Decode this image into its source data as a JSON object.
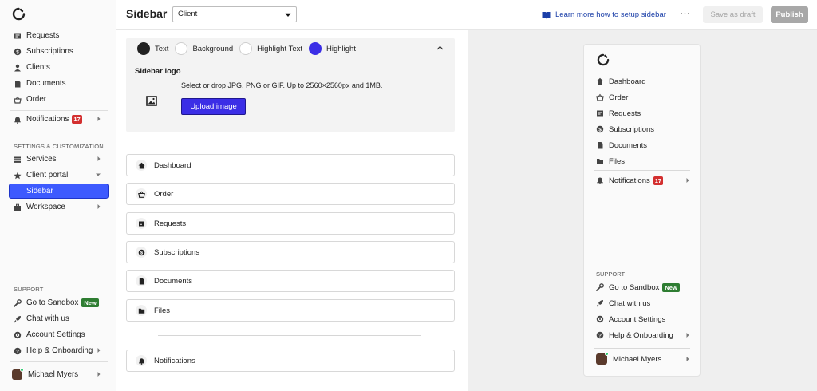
{
  "sidebar": {
    "main_items": [
      {
        "label": "Requests",
        "icon": "requests-icon"
      },
      {
        "label": "Subscriptions",
        "icon": "subscriptions-icon"
      },
      {
        "label": "Clients",
        "icon": "clients-icon"
      },
      {
        "label": "Documents",
        "icon": "documents-icon"
      },
      {
        "label": "Order",
        "icon": "order-icon"
      }
    ],
    "notifications": {
      "label": "Notifications",
      "badge": "17"
    },
    "settings_header": "SETTINGS & CUSTOMIZATION",
    "settings_items": [
      {
        "label": "Services"
      },
      {
        "label": "Client portal"
      },
      {
        "label": "Sidebar"
      },
      {
        "label": "Workspace"
      }
    ],
    "support_header": "SUPPORT",
    "support_items": [
      {
        "label": "Go to Sandbox",
        "badge": "New"
      },
      {
        "label": "Chat with us"
      },
      {
        "label": "Account Settings"
      },
      {
        "label": "Help & Onboarding"
      }
    ],
    "user": {
      "name": "Michael Myers"
    }
  },
  "header": {
    "title": "Sidebar",
    "select_value": "Client",
    "learn_link": "Learn more how to setup sidebar",
    "more_label": "···",
    "draft_label": "Save as draft",
    "publish_label": "Publish"
  },
  "editor": {
    "colors": [
      {
        "label": "Text",
        "color": "#222222"
      },
      {
        "label": "Background",
        "color": "#ffffff"
      },
      {
        "label": "Highlight Text",
        "color": "#ffffff"
      },
      {
        "label": "Highlight",
        "color": "#3b2ee6"
      }
    ],
    "logo_heading": "Sidebar logo",
    "logo_hint": "Select or drop JPG, PNG or GIF. Up to 2560×2560px and 1MB.",
    "upload_label": "Upload image",
    "rows": [
      {
        "label": "Dashboard"
      },
      {
        "label": "Order"
      },
      {
        "label": "Requests"
      },
      {
        "label": "Subscriptions"
      },
      {
        "label": "Documents"
      },
      {
        "label": "Files"
      }
    ],
    "notifications_row": "Notifications"
  },
  "preview": {
    "items": [
      {
        "label": "Dashboard"
      },
      {
        "label": "Order"
      },
      {
        "label": "Requests"
      },
      {
        "label": "Subscriptions"
      },
      {
        "label": "Documents"
      },
      {
        "label": "Files"
      }
    ],
    "notifications": {
      "label": "Notifications",
      "badge": "17"
    },
    "support_header": "SUPPORT",
    "support_items": [
      {
        "label": "Go to Sandbox",
        "badge": "New"
      },
      {
        "label": "Chat with us"
      },
      {
        "label": "Account Settings"
      },
      {
        "label": "Help & Onboarding"
      }
    ],
    "user": {
      "name": "Michael Myers"
    }
  },
  "colors": {
    "accent": "#3d5afe",
    "upload": "#3b2ee6",
    "badge_red": "#d32f2f",
    "badge_green": "#2e7d32",
    "link": "#1b3fa8"
  }
}
